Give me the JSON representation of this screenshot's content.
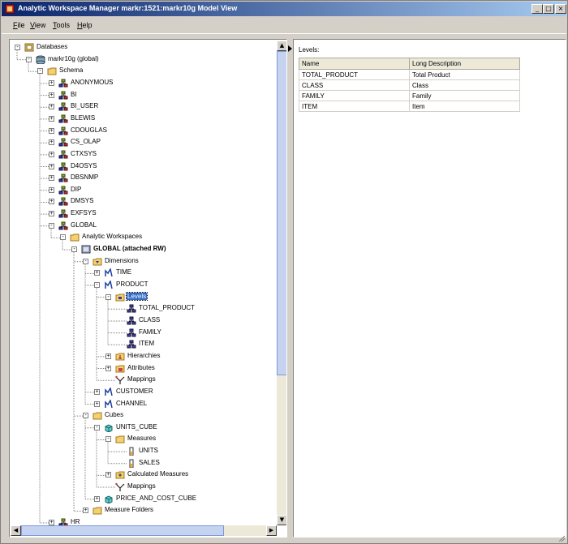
{
  "window": {
    "title": "Analytic Workspace Manager  markr:1521:markr10g  Model View",
    "minimize": "_",
    "maximize": "□",
    "close": "×"
  },
  "menu": [
    "File",
    "View",
    "Tools",
    "Help"
  ],
  "tree": [
    {
      "level": 0,
      "label": "Databases",
      "icon": "databases-icon",
      "exp": "-"
    },
    {
      "level": 1,
      "label": "markr10g (global)",
      "icon": "database-icon",
      "exp": "-"
    },
    {
      "level": 2,
      "label": "Schema",
      "icon": "folder-icon",
      "exp": "-"
    },
    {
      "level": 3,
      "label": "ANONYMOUS",
      "icon": "schema-icon",
      "exp": "+"
    },
    {
      "level": 3,
      "label": "BI",
      "icon": "schema-icon",
      "exp": "+"
    },
    {
      "level": 3,
      "label": "BI_USER",
      "icon": "schema-icon",
      "exp": "+"
    },
    {
      "level": 3,
      "label": "BLEWIS",
      "icon": "schema-icon",
      "exp": "+"
    },
    {
      "level": 3,
      "label": "CDOUGLAS",
      "icon": "schema-icon",
      "exp": "+"
    },
    {
      "level": 3,
      "label": "CS_OLAP",
      "icon": "schema-icon",
      "exp": "+"
    },
    {
      "level": 3,
      "label": "CTXSYS",
      "icon": "schema-icon",
      "exp": "+"
    },
    {
      "level": 3,
      "label": "D4OSYS",
      "icon": "schema-icon",
      "exp": "+"
    },
    {
      "level": 3,
      "label": "DBSNMP",
      "icon": "schema-icon",
      "exp": "+"
    },
    {
      "level": 3,
      "label": "DIP",
      "icon": "schema-icon",
      "exp": "+"
    },
    {
      "level": 3,
      "label": "DMSYS",
      "icon": "schema-icon",
      "exp": "+"
    },
    {
      "level": 3,
      "label": "EXFSYS",
      "icon": "schema-icon",
      "exp": "+"
    },
    {
      "level": 3,
      "label": "GLOBAL",
      "icon": "schema-icon",
      "exp": "-"
    },
    {
      "level": 4,
      "label": "Analytic Workspaces",
      "icon": "folder-icon",
      "exp": "-"
    },
    {
      "level": 5,
      "label": "GLOBAL (attached RW)",
      "icon": "workspace-icon",
      "exp": "-",
      "bold": true
    },
    {
      "level": 6,
      "label": "Dimensions",
      "icon": "dimensions-folder-icon",
      "exp": "-"
    },
    {
      "level": 7,
      "label": "TIME",
      "icon": "dimension-icon",
      "exp": "+"
    },
    {
      "level": 7,
      "label": "PRODUCT",
      "icon": "dimension-icon",
      "exp": "-"
    },
    {
      "level": 8,
      "label": "Levels",
      "icon": "levels-folder-icon",
      "exp": "-",
      "selected": true
    },
    {
      "level": 9,
      "label": "TOTAL_PRODUCT",
      "icon": "level-icon",
      "exp": ""
    },
    {
      "level": 9,
      "label": "CLASS",
      "icon": "level-icon",
      "exp": ""
    },
    {
      "level": 9,
      "label": "FAMILY",
      "icon": "level-icon",
      "exp": ""
    },
    {
      "level": 9,
      "label": "ITEM",
      "icon": "level-icon",
      "exp": ""
    },
    {
      "level": 8,
      "label": "Hierarchies",
      "icon": "hierarchies-icon",
      "exp": "+"
    },
    {
      "level": 8,
      "label": "Attributes",
      "icon": "attributes-icon",
      "exp": "+"
    },
    {
      "level": 8,
      "label": "Mappings",
      "icon": "mappings-icon",
      "exp": ""
    },
    {
      "level": 7,
      "label": "CUSTOMER",
      "icon": "dimension-icon",
      "exp": "+"
    },
    {
      "level": 7,
      "label": "CHANNEL",
      "icon": "dimension-icon",
      "exp": "+"
    },
    {
      "level": 6,
      "label": "Cubes",
      "icon": "folder-icon",
      "exp": "-"
    },
    {
      "level": 7,
      "label": "UNITS_CUBE",
      "icon": "cube-icon",
      "exp": "-"
    },
    {
      "level": 8,
      "label": "Measures",
      "icon": "folder-icon",
      "exp": "-"
    },
    {
      "level": 9,
      "label": "UNITS",
      "icon": "measure-icon",
      "exp": ""
    },
    {
      "level": 9,
      "label": "SALES",
      "icon": "measure-icon",
      "exp": ""
    },
    {
      "level": 8,
      "label": "Calculated Measures",
      "icon": "calc-measures-icon",
      "exp": "+"
    },
    {
      "level": 8,
      "label": "Mappings",
      "icon": "mappings-icon",
      "exp": ""
    },
    {
      "level": 7,
      "label": "PRICE_AND_COST_CUBE",
      "icon": "cube-icon",
      "exp": "+"
    },
    {
      "level": 6,
      "label": "Measure Folders",
      "icon": "folder-icon",
      "exp": "+"
    },
    {
      "level": 3,
      "label": "HR",
      "icon": "schema-icon",
      "exp": "+"
    }
  ],
  "levels_panel": {
    "title": "Levels:",
    "columns": [
      "Name",
      "Long Description"
    ],
    "rows": [
      [
        "TOTAL_PRODUCT",
        "Total Product"
      ],
      [
        "CLASS",
        "Class"
      ],
      [
        "FAMILY",
        "Family"
      ],
      [
        "ITEM",
        "Item"
      ]
    ]
  },
  "colors": {
    "selection": "#316ac5",
    "title_start": "#0a246a",
    "title_end": "#a6caf0"
  }
}
